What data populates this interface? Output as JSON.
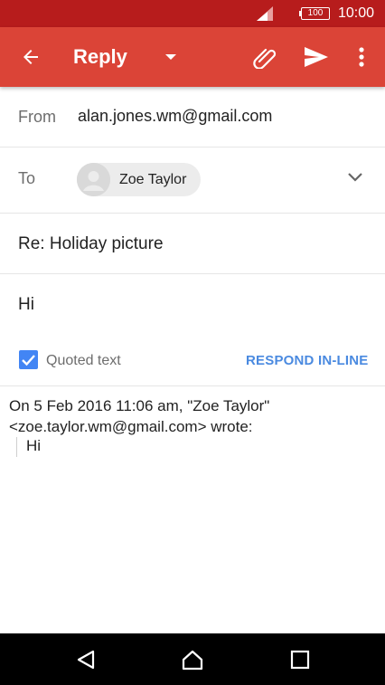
{
  "status_bar": {
    "battery": "100",
    "time": "10:00"
  },
  "app_bar": {
    "title": "Reply"
  },
  "compose": {
    "from_label": "From",
    "from_value": "alan.jones.wm@gmail.com",
    "to_label": "To",
    "to_recipient": "Zoe Taylor",
    "subject": "Re: Holiday picture",
    "body": "Hi"
  },
  "quoted": {
    "checked": true,
    "label": "Quoted text",
    "respond_button": "RESPOND IN-LINE",
    "header_line1": "On 5 Feb 2016 11:06 am, \"Zoe Taylor\"",
    "header_line2": "<zoe.taylor.wm@gmail.com> wrote:",
    "body": "Hi"
  },
  "colors": {
    "status_bar": "#b71c1c",
    "app_bar": "#db4437",
    "accent_blue": "#4285f4"
  },
  "icons": {
    "back": "arrow-back-icon",
    "dropdown": "caret-down-icon",
    "attach": "paperclip-icon",
    "send": "send-icon",
    "more": "more-vert-icon",
    "expand": "chevron-down-icon",
    "nav_back": "nav-back-icon",
    "nav_home": "nav-home-icon",
    "nav_recents": "nav-recents-icon"
  }
}
